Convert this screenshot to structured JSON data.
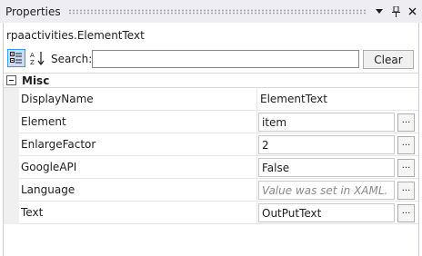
{
  "panel": {
    "title": "Properties",
    "object_name": "rpaactivities.ElementText"
  },
  "toolbar": {
    "search_label": "Search:",
    "search_value": "",
    "clear_label": "Clear",
    "icons": [
      "categorized-view-icon",
      "alphabetical-sort-icon"
    ]
  },
  "category": {
    "label": "Misc"
  },
  "properties": [
    {
      "name": "DisplayName",
      "value": "ElementText",
      "editor": "none"
    },
    {
      "name": "Element",
      "value": "item",
      "editor": "ellipsis"
    },
    {
      "name": "EnlargeFactor",
      "value": "2",
      "editor": "ellipsis"
    },
    {
      "name": "GoogleAPI",
      "value": "False",
      "editor": "ellipsis"
    },
    {
      "name": "Language",
      "value": "Value was set in XAML.",
      "editor": "ellipsis",
      "placeholder": true
    },
    {
      "name": "Text",
      "value": "OutPutText",
      "editor": "ellipsis"
    }
  ],
  "ellipsis_label": "..."
}
